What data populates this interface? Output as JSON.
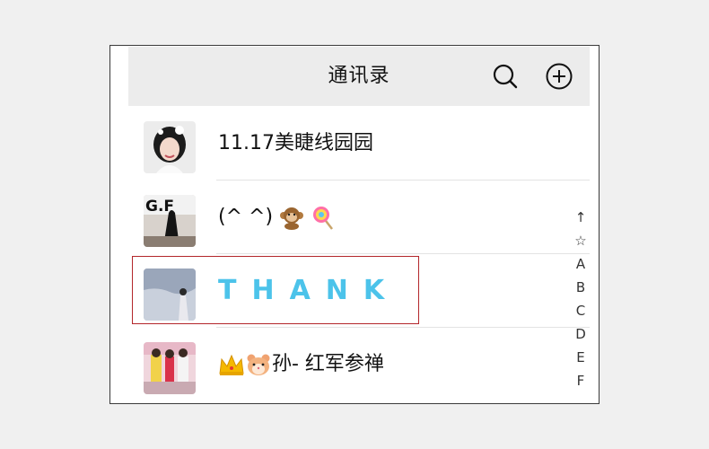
{
  "header": {
    "title": "通讯录",
    "search_icon": "search-icon",
    "add_icon": "add-circle-icon"
  },
  "contacts": [
    {
      "name": "11.17美睫线园园",
      "avatar": "avatar-girl-portrait"
    },
    {
      "name": "(^ ^)",
      "emojis": [
        "monkey-emoji",
        "lollipop-emoji"
      ],
      "avatar": "avatar-gf-photo"
    },
    {
      "name": "THANK",
      "avatar": "avatar-beach-photo",
      "highlighted": true
    },
    {
      "name": "孙- 红军参禅",
      "emojis_prefix": [
        "crown-emoji",
        "hamster-emoji"
      ],
      "avatar": "avatar-group-photo"
    }
  ],
  "index_bar": [
    "↑",
    "☆",
    "A",
    "B",
    "C",
    "D",
    "E",
    "F"
  ],
  "colors": {
    "header_bg": "#ececec",
    "thank_text": "#4cc3ea",
    "highlight_border": "#b3262b"
  }
}
